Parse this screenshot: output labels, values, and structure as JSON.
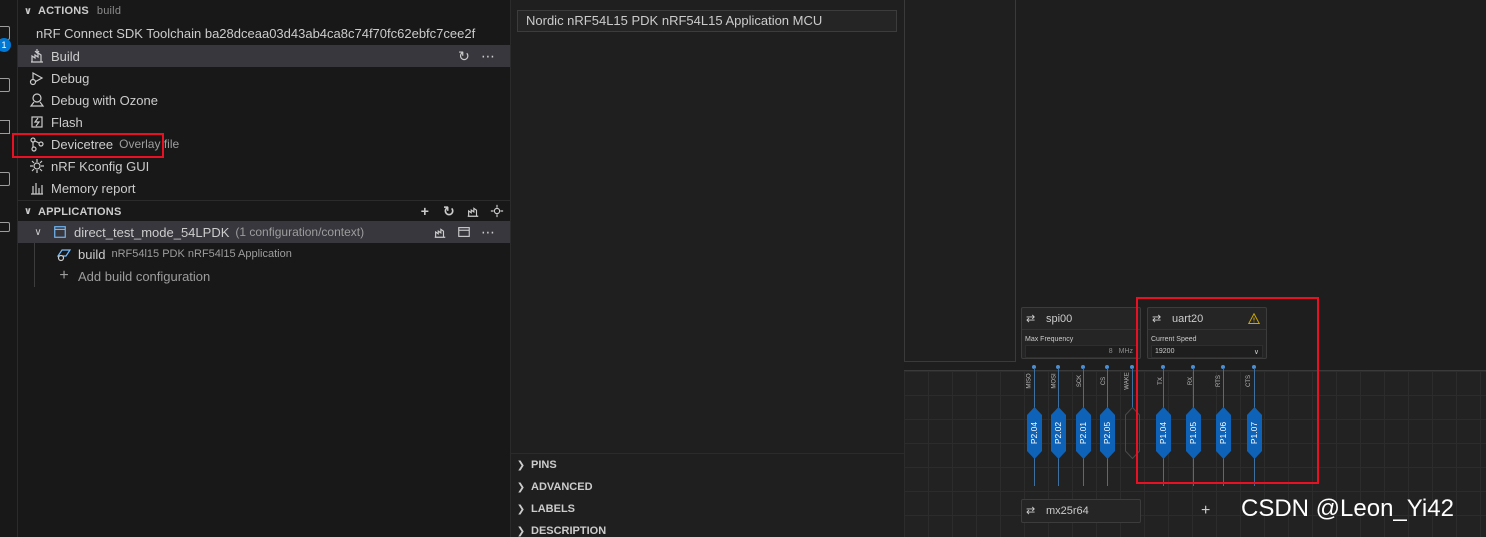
{
  "actions": {
    "header": "ACTIONS",
    "context": "build",
    "toolchain": "nRF Connect SDK Toolchain ba28dceaa03d43ab4ca8c74f70fc62ebfc7cee2f",
    "items": [
      {
        "label": "Build",
        "icon": "build-icon"
      },
      {
        "label": "Debug",
        "icon": "debug-icon"
      },
      {
        "label": "Debug with Ozone",
        "icon": "ozone-icon"
      },
      {
        "label": "Flash",
        "icon": "flash-icon"
      },
      {
        "label": "Devicetree",
        "desc": "Overlay file",
        "icon": "devicetree-icon"
      },
      {
        "label": "nRF Kconfig GUI",
        "icon": "kconfig-icon"
      },
      {
        "label": "Memory report",
        "icon": "memory-report-icon"
      }
    ]
  },
  "applications": {
    "header": "APPLICATIONS",
    "app_name": "direct_test_mode_54LPDK",
    "app_desc": "(1 configuration/context)",
    "build_label": "build",
    "build_desc": "nRF54l15 PDK nRF54l15 Application",
    "add_build": "Add build configuration"
  },
  "board": {
    "name": "Nordic nRF54L15 PDK nRF54L15 Application MCU"
  },
  "sections": [
    "PINS",
    "ADVANCED",
    "LABELS",
    "DESCRIPTION"
  ],
  "canvas": {
    "spi": {
      "name": "spi00",
      "field_label": "Max Frequency",
      "field_value": "8",
      "field_unit": "MHz",
      "signals": [
        "MISO",
        "MOSI",
        "SCK",
        "CS",
        "WAKE"
      ],
      "pins": [
        "P2.04",
        "P2.02",
        "P2.01",
        "P2.05"
      ]
    },
    "uart": {
      "name": "uart20",
      "field_label": "Current Speed",
      "field_value": "19200",
      "signals": [
        "TX",
        "RX",
        "RTS",
        "CTS"
      ],
      "pins": [
        "P1.04",
        "P1.05",
        "P1.06",
        "P1.07"
      ]
    },
    "flash": {
      "name": "mx25r64"
    }
  },
  "colors": {
    "highlight": "#e81123",
    "pin": "#0e63b8",
    "warning": "#cca700"
  },
  "watermark": "CSDN @Leon_Yi42"
}
